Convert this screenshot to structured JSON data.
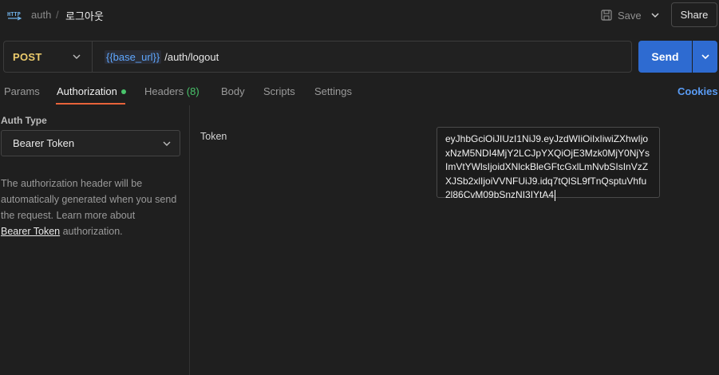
{
  "breadcrumb": {
    "parent": "auth",
    "separator": "/",
    "current": "로그아웃"
  },
  "toolbar": {
    "save_label": "Save",
    "share_label": "Share"
  },
  "request": {
    "method": "POST",
    "url_variable": "{{base_url}}",
    "url_path": "/auth/logout",
    "send_label": "Send"
  },
  "tabs": {
    "params": "Params",
    "authorization": "Authorization",
    "headers": "Headers",
    "headers_count": "(8)",
    "body": "Body",
    "scripts": "Scripts",
    "settings": "Settings",
    "cookies": "Cookies"
  },
  "auth": {
    "type_label": "Auth Type",
    "type_value": "Bearer Token",
    "description_prefix": "The authorization header will be automatically generated when you send the request. Learn more about",
    "description_link": "Bearer Token",
    "description_suffix": "authorization.",
    "token_label": "Token",
    "token_value": "eyJhbGciOiJIUzI1NiJ9.eyJzdWIiOiIxIiwiZXhwIjoxNzM5NDI4MjY2LCJpYXQiOjE3Mzk0MjY0NjYsImVtYWlsIjoidXNlckBleGFtcGxlLmNvbSIsInVzZXJSb2xlIjoiVVNFUiJ9.idq7tQlSL9fTnQsptuVhfu2l86CvM09bSnzNI3IYtA4"
  },
  "colors": {
    "background": "#1f1f1f",
    "method_post": "#eccb6c",
    "send_button": "#2e6bd1",
    "active_tab_underline": "#e8633a",
    "status_green": "#49c46b",
    "link_blue": "#5a9cf5",
    "variable_blue": "#5ea7ff"
  },
  "icons": {
    "request_type": "http-icon",
    "save": "save-icon",
    "dropdown": "chevron-down-icon"
  }
}
